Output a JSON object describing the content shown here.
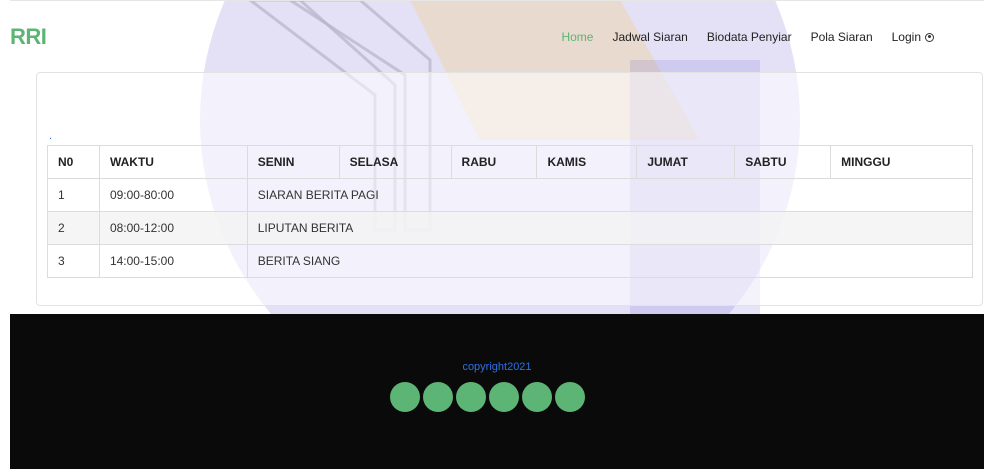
{
  "brand": "RRI",
  "nav": [
    {
      "label": "Home",
      "active": true
    },
    {
      "label": "Jadwal Siaran",
      "active": false
    },
    {
      "label": "Biodata Penyiar",
      "active": false
    },
    {
      "label": "Pola Siaran",
      "active": false
    },
    {
      "label": "Login",
      "active": false
    }
  ],
  "card": {
    "marker": "."
  },
  "table": {
    "headers": [
      "N0",
      "WAKTU",
      "SENIN",
      "SELASA",
      "RABU",
      "KAMIS",
      "JUMAT",
      "SABTU",
      "MINGGU"
    ],
    "rows": [
      {
        "no": "1",
        "waktu": "09:00-80:00",
        "program": "SIARAN BERITA PAGI"
      },
      {
        "no": "2",
        "waktu": "08:00-12:00",
        "program": "LIPUTAN BERITA"
      },
      {
        "no": "3",
        "waktu": "14:00-15:00",
        "program": "BERITA SIANG"
      }
    ]
  },
  "footer": {
    "copyright": "copyright2021",
    "socials": [
      "social-icon-1",
      "social-icon-2",
      "social-icon-3",
      "social-icon-4",
      "social-icon-5",
      "social-icon-6"
    ],
    "social_color": "#5cb574"
  },
  "colors": {
    "accent": "#5cb574",
    "link": "#2f6fe0",
    "footer_bg": "#0a0a0a"
  }
}
